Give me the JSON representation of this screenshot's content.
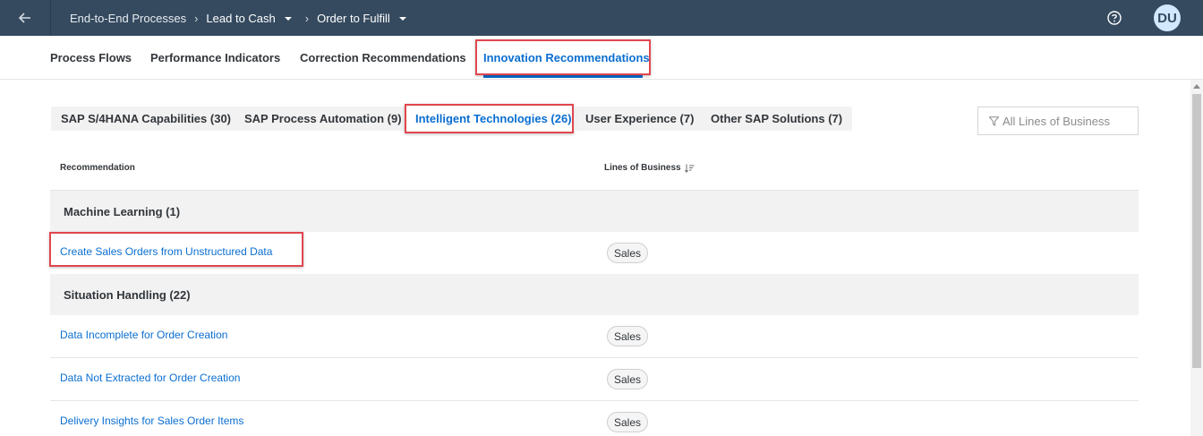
{
  "shellbar": {
    "back_icon": "arrow-left-icon",
    "breadcrumb": {
      "root": "End-to-End Processes",
      "level1": "Lead to Cash",
      "level2": "Order to Fulfill"
    },
    "help_icon": "help-icon",
    "avatar_initials": "DU",
    "background_color": "#354a5f"
  },
  "tabs": [
    {
      "label": "Process Flows"
    },
    {
      "label": "Performance Indicators"
    },
    {
      "label": "Correction Recommendations"
    },
    {
      "label": "Innovation Recommendations",
      "active": true
    }
  ],
  "subtabs": [
    {
      "label": "SAP S/4HANA Capabilities (30)"
    },
    {
      "label": "SAP Process Automation (9)"
    },
    {
      "label": "Intelligent Technologies (26)",
      "active": true
    },
    {
      "label": "User Experience (7)"
    },
    {
      "label": "Other SAP Solutions (7)"
    }
  ],
  "filter": {
    "placeholder": "All Lines of Business",
    "icon": "filter-icon"
  },
  "table": {
    "columns": {
      "recommendation": "Recommendation",
      "lines_of_business": "Lines of Business"
    },
    "groups": [
      {
        "title": "Machine Learning (1)",
        "rows": [
          {
            "recommendation": "Create Sales Orders from Unstructured Data",
            "lob": "Sales"
          }
        ]
      },
      {
        "title": "Situation Handling (22)",
        "rows": [
          {
            "recommendation": "Data Incomplete for Order Creation",
            "lob": "Sales"
          },
          {
            "recommendation": "Data Not Extracted for Order Creation",
            "lob": "Sales"
          },
          {
            "recommendation": "Delivery Insights for Sales Order Items",
            "lob": "Sales"
          }
        ]
      }
    ]
  },
  "colors": {
    "accent": "#0a6ed1",
    "highlight": "#e0474f"
  }
}
